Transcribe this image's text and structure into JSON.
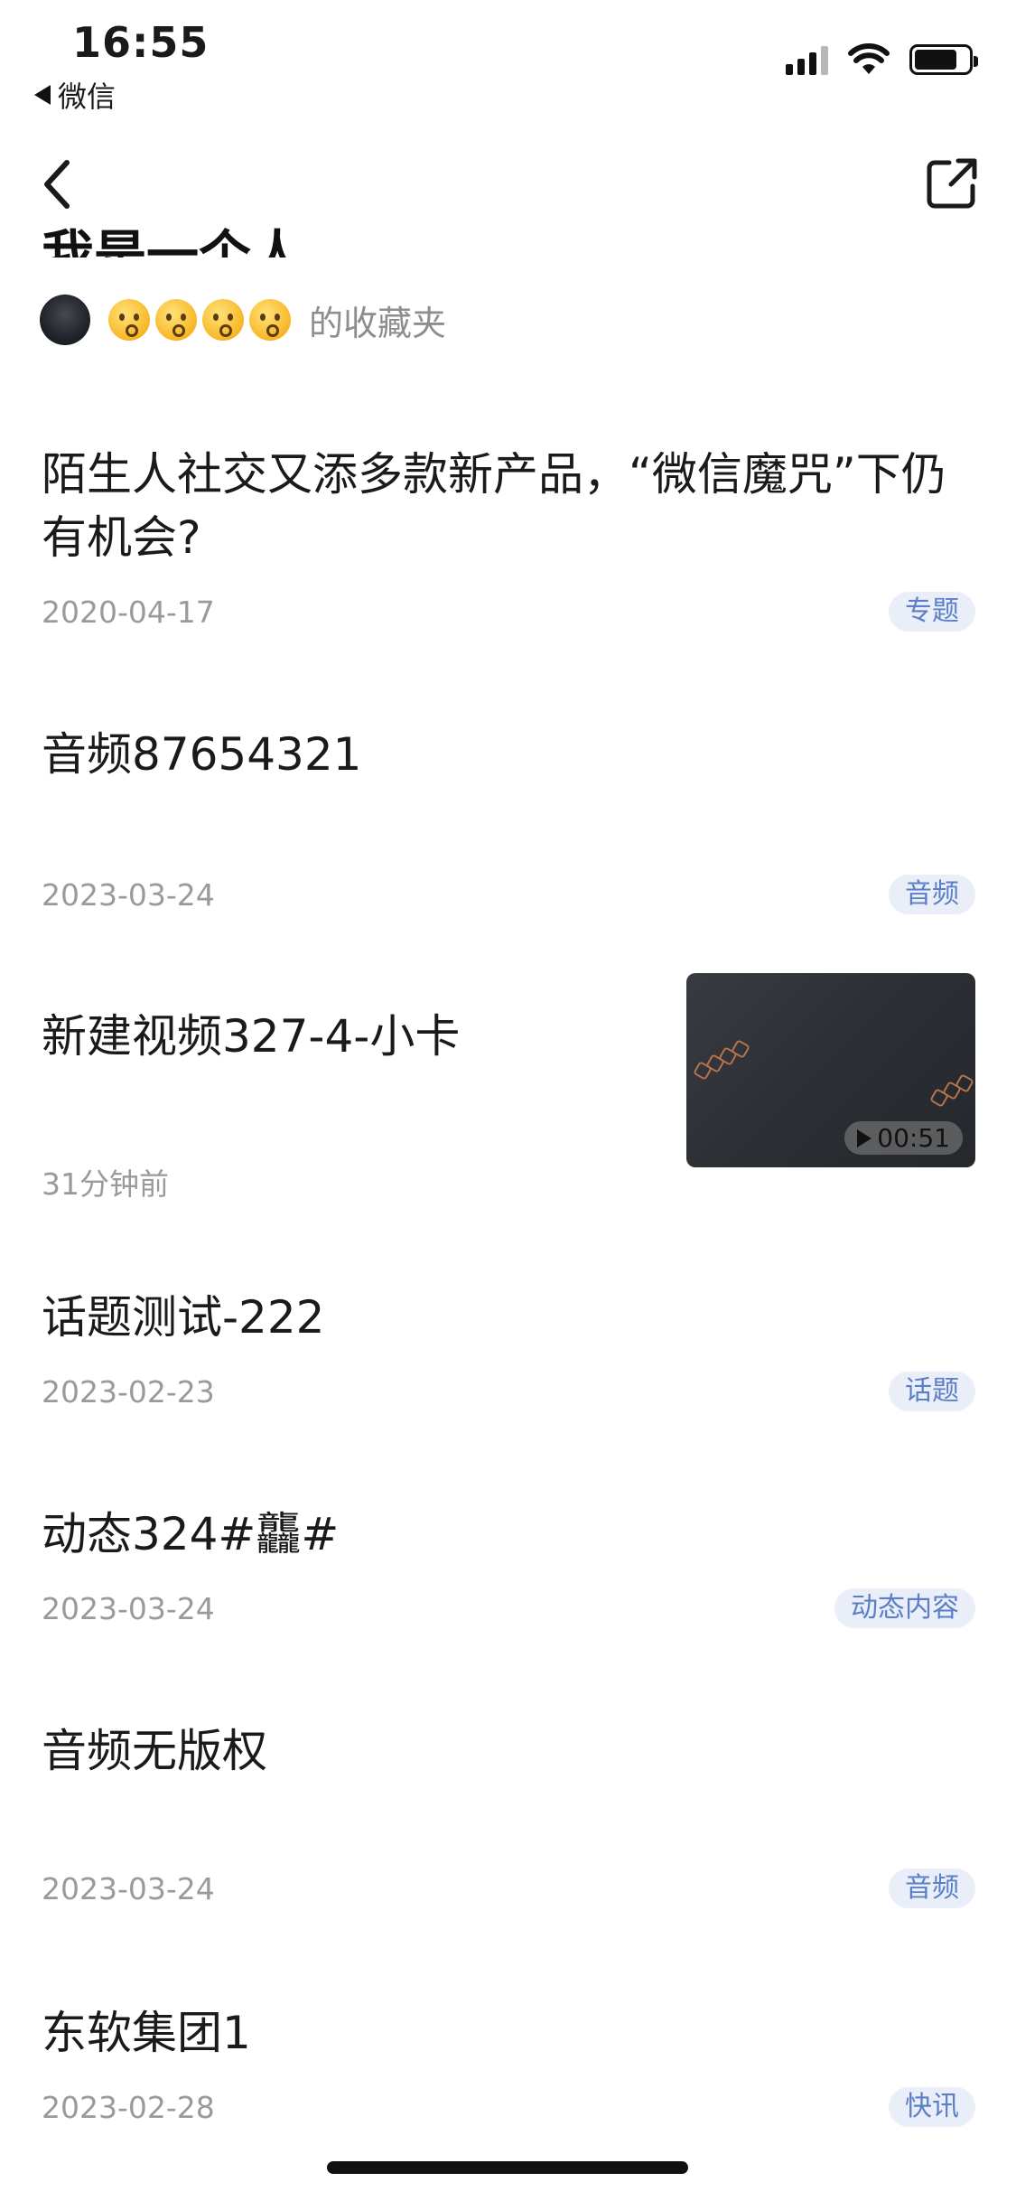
{
  "status_bar": {
    "time": "16:55",
    "back_app_label": "微信",
    "icons": [
      "back-triangle-icon",
      "signal-icon",
      "wifi-icon",
      "battery-icon"
    ]
  },
  "nav": {
    "icons": [
      "back-chevron-icon",
      "share-external-icon"
    ]
  },
  "header": {
    "title_partial": "我是一个人",
    "owner_suffix": "的收藏夹",
    "emoji_count": 4
  },
  "items": [
    {
      "title": "陌生人社交又添多款新产品，“微信魔咒”下仍有机会?",
      "date": "2020-04-17",
      "tag": "专题"
    },
    {
      "title": "音频87654321",
      "date": "2023-03-24",
      "tag": "音频"
    },
    {
      "title": "新建视频327-4-小卡",
      "date": "31分钟前",
      "video_duration": "00:51"
    },
    {
      "title": "话题测试-222",
      "date": "2023-02-23",
      "tag": "话题"
    },
    {
      "title": "动态324#龘#",
      "date": "2023-03-24",
      "tag": "动态内容"
    },
    {
      "title": "音频无版权",
      "date": "2023-03-24",
      "tag": "音频"
    },
    {
      "title": "东软集团1",
      "date": "2023-02-28",
      "tag": "快讯"
    }
  ]
}
